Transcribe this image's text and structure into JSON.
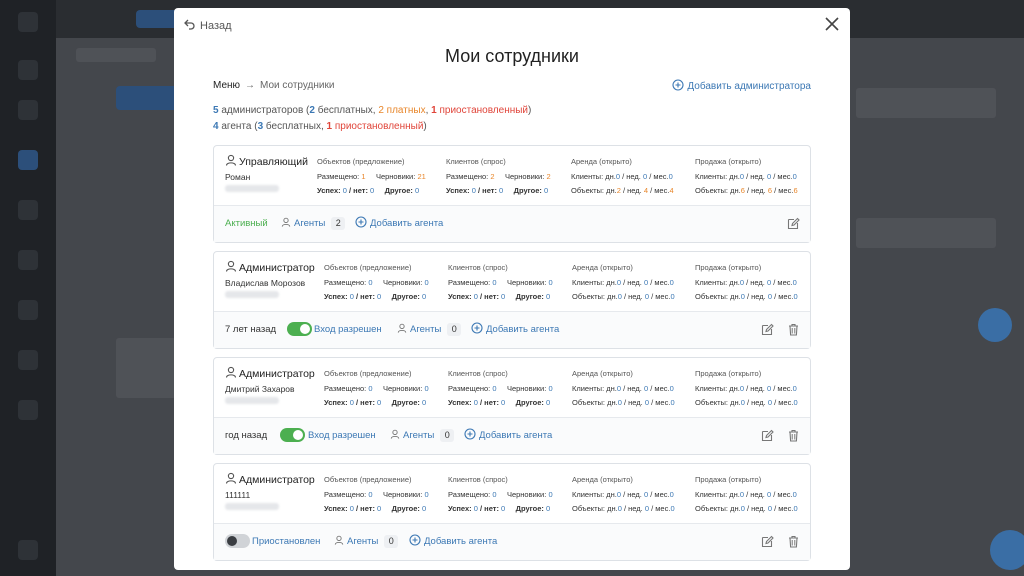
{
  "header": {
    "back_label": "Назад",
    "title": "Мои сотрудники"
  },
  "breadcrumb": {
    "first": "Меню",
    "arrow": "→",
    "current": "Мои сотрудники"
  },
  "add_admin_label": "Добавить администратора",
  "summary": {
    "admins_count": "5",
    "admins_word": " администраторов (",
    "admins_free_count": "2",
    "admins_free_word": " бесплатных, ",
    "admins_paid": "2 платных",
    "admins_sep": ", ",
    "admins_paused_count": "1",
    "admins_paused_word": " приостановленный",
    "admins_close": ")",
    "agents_count": "4",
    "agents_word": " агента (",
    "agents_free_count": "3",
    "agents_free_word": " бесплатных, ",
    "agents_paused_count": "1",
    "agents_paused_word": " приостановленный",
    "agents_close": ")"
  },
  "labels": {
    "objects": "Объектов (предложение)",
    "clients": "Клиентов (спрос)",
    "rent": "Аренда (открыто)",
    "sale": "Продажа (открыто)",
    "placed": "Размещено:",
    "drafts": "Черновики:",
    "success": "Успех:",
    "no": "/ нет:",
    "other": "Другое:",
    "rent_clients": "Клиенты: дн.",
    "rent_objects": "Объекты: дн.",
    "week": "/ нед.",
    "month": "/ мес.",
    "agents": "Агенты",
    "add_agent": "Добавить агента"
  },
  "cards": [
    {
      "role": "Управляющий",
      "name": "Роман",
      "obj": {
        "placed": "1",
        "drafts": "21",
        "success": "0",
        "no": "0",
        "other": "0"
      },
      "cli": {
        "placed": "2",
        "drafts": "2",
        "success": "0",
        "no": "0",
        "other": "0"
      },
      "rent": {
        "c_d": "0",
        "c_w": "0",
        "c_m": "0",
        "o_d": "2",
        "o_w": "4",
        "o_m": "4"
      },
      "sale": {
        "c_d": "0",
        "c_w": "0",
        "c_m": "0",
        "o_d": "6",
        "o_w": "6",
        "o_m": "6"
      },
      "status": "Активный",
      "agents_count": "2"
    },
    {
      "role": "Администратор",
      "name": "Владислав Морозов",
      "obj": {
        "placed": "0",
        "drafts": "0",
        "success": "0",
        "no": "0",
        "other": "0"
      },
      "cli": {
        "placed": "0",
        "drafts": "0",
        "success": "0",
        "no": "0",
        "other": "0"
      },
      "rent": {
        "c_d": "0",
        "c_w": "0",
        "c_m": "0",
        "o_d": "0",
        "o_w": "0",
        "o_m": "0"
      },
      "sale": {
        "c_d": "0",
        "c_w": "0",
        "c_m": "0",
        "o_d": "0",
        "o_w": "0",
        "o_m": "0"
      },
      "status": "7 лет назад",
      "toggle_label": "Вход разрешен",
      "agents_count": "0"
    },
    {
      "role": "Администратор",
      "name": "Дмитрий Захаров",
      "obj": {
        "placed": "0",
        "drafts": "0",
        "success": "0",
        "no": "0",
        "other": "0"
      },
      "cli": {
        "placed": "0",
        "drafts": "0",
        "success": "0",
        "no": "0",
        "other": "0"
      },
      "rent": {
        "c_d": "0",
        "c_w": "0",
        "c_m": "0",
        "o_d": "0",
        "o_w": "0",
        "o_m": "0"
      },
      "sale": {
        "c_d": "0",
        "c_w": "0",
        "c_m": "0",
        "o_d": "0",
        "o_w": "0",
        "o_m": "0"
      },
      "status": "год назад",
      "toggle_label": "Вход разрешен",
      "agents_count": "0"
    },
    {
      "role": "Администратор",
      "name": "111111",
      "obj": {
        "placed": "0",
        "drafts": "0",
        "success": "0",
        "no": "0",
        "other": "0"
      },
      "cli": {
        "placed": "0",
        "drafts": "0",
        "success": "0",
        "no": "0",
        "other": "0"
      },
      "rent": {
        "c_d": "0",
        "c_w": "0",
        "c_m": "0",
        "o_d": "0",
        "o_w": "0",
        "o_m": "0"
      },
      "sale": {
        "c_d": "0",
        "c_w": "0",
        "c_m": "0",
        "o_d": "0",
        "o_w": "0",
        "o_m": "0"
      },
      "toggle_label": "Приостановлен",
      "agents_count": "0"
    }
  ],
  "colors": {
    "accent": "#3c78b4",
    "active": "#4caf50",
    "orange": "#e8862a",
    "red": "#e0453a"
  }
}
